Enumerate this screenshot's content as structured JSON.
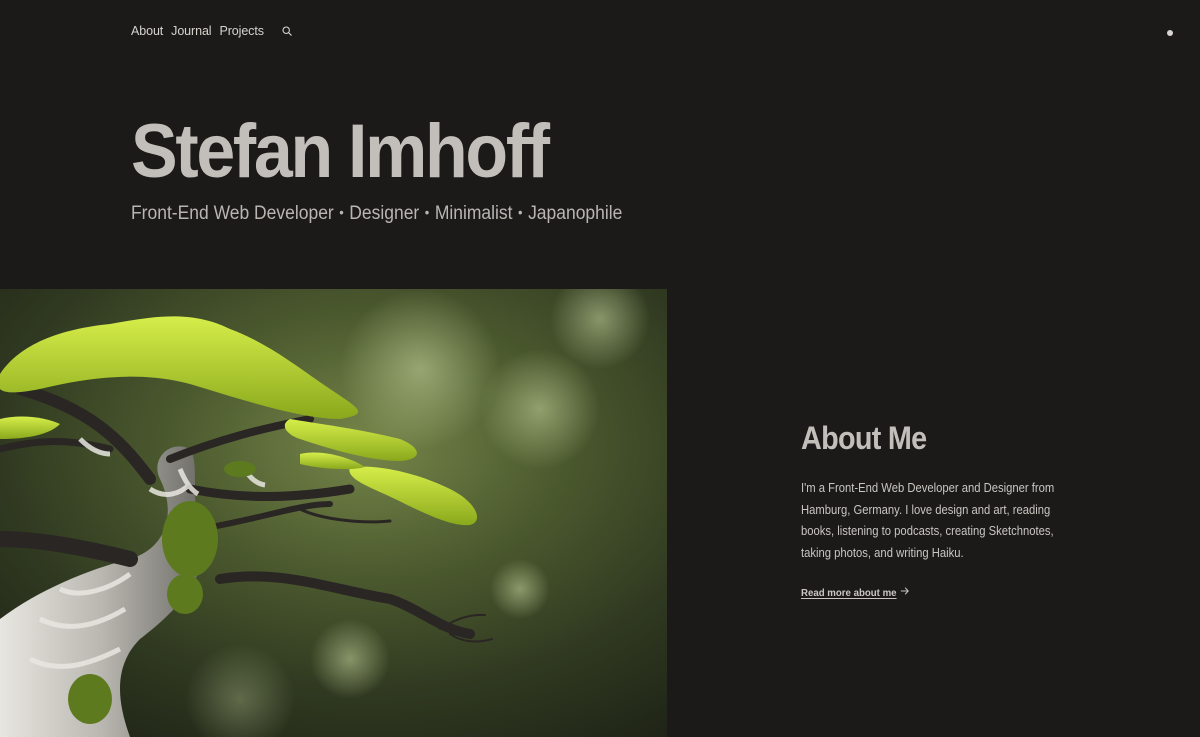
{
  "nav": {
    "items": [
      {
        "label": "About"
      },
      {
        "label": "Journal"
      },
      {
        "label": "Projects"
      }
    ],
    "search_icon": "search-icon",
    "theme_toggle_icon": "theme-dot-icon"
  },
  "hero": {
    "title": "Stefan Imhoff",
    "tagline": [
      "Front-End Web Developer",
      "Designer",
      "Minimalist",
      "Japanophile"
    ],
    "separator": "•"
  },
  "image": {
    "subject": "bonsai tree with moss-covered branches against blurred green background"
  },
  "about": {
    "heading": "About Me",
    "body": "I'm a Front-End Web Developer and Designer from Hamburg, Germany. I love design and art, reading books, listening to podcasts, creating Sketchnotes, taking photos, and writing Haiku.",
    "link_label": "Read more about me",
    "link_icon": "arrow-right-icon"
  },
  "colors": {
    "background": "#1b1a19",
    "text": "#c9c6c1",
    "heading": "#c2bfba",
    "moss": "#b5d42a"
  }
}
